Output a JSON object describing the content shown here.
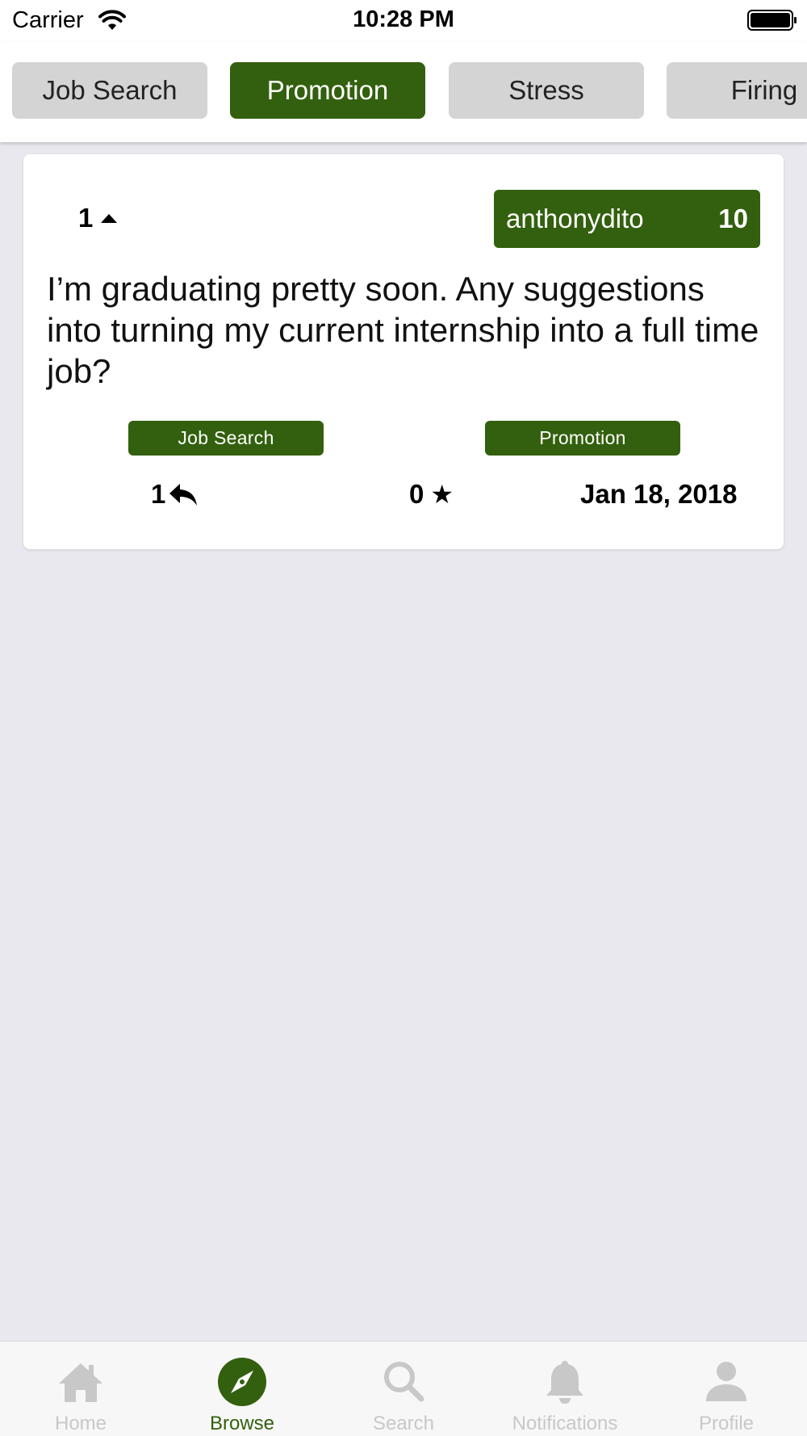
{
  "status_bar": {
    "carrier": "Carrier",
    "time": "10:28 PM",
    "wifi_icon": "wifi-icon",
    "battery_icon": "battery-icon"
  },
  "categories": [
    {
      "label": "Job Search",
      "active": false
    },
    {
      "label": "Promotion",
      "active": true
    },
    {
      "label": "Stress",
      "active": false
    },
    {
      "label": "Firing",
      "active": false
    }
  ],
  "post": {
    "upvotes": "1",
    "upvote_icon": "upvote-arrow-icon",
    "author": "anthonydito",
    "author_score": "10",
    "text": "I’m graduating pretty soon. Any suggestions into turning my current internship into a full time job?",
    "tags": [
      "Job Search",
      "Promotion"
    ],
    "replies": "1",
    "reply_icon": "reply-icon",
    "stars": "0",
    "star_icon": "star-icon",
    "date": "Jan 18, 2018"
  },
  "tab_bar": {
    "tabs": [
      {
        "label": "Home",
        "icon": "home-icon",
        "active": false
      },
      {
        "label": "Browse",
        "icon": "compass-icon",
        "active": true
      },
      {
        "label": "Search",
        "icon": "search-icon",
        "active": false
      },
      {
        "label": "Notifications",
        "icon": "bell-icon",
        "active": false
      },
      {
        "label": "Profile",
        "icon": "person-icon",
        "active": false
      }
    ]
  },
  "colors": {
    "accent": "#33600e",
    "inactive_chip": "#d4d4d4",
    "background": "#e9e8ee",
    "tab_inactive": "#c8c8c8"
  }
}
